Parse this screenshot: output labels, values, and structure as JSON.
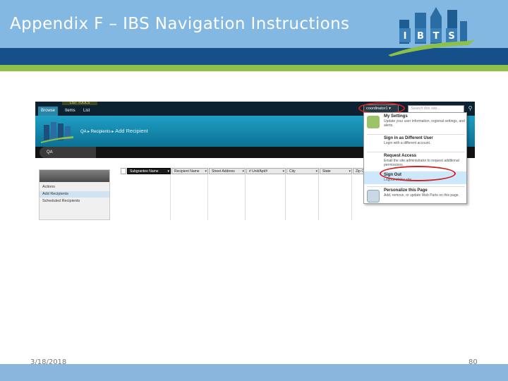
{
  "slide": {
    "title": "Appendix F – IBS Navigation Instructions",
    "date": "3/18/2018",
    "page_number": "80",
    "logo_letters": [
      "I",
      "B",
      "T",
      "S"
    ]
  },
  "screenshot": {
    "ribbon_label": "LIST TOOLS",
    "tabs": [
      "Browse",
      "Items",
      "List"
    ],
    "selected_tab": "Browse",
    "breadcrumb": {
      "site": "QA",
      "list": "Recipients",
      "page": "Add Recipient"
    },
    "user_button": "coordinator1 ▾",
    "search_placeholder": "Search this site...",
    "qa_label": "QA",
    "left_nav": [
      "Actions",
      "Add Recipients",
      "Scheduled Recipients"
    ],
    "left_nav_selected": "Add Recipients",
    "grid_columns": [
      "Subgrantee Name",
      "Recipient Name",
      "Street Address",
      "# Unit/Apt/#",
      "City",
      "State",
      "Zip Co"
    ],
    "user_menu": [
      {
        "title": "My Settings",
        "desc": "Update your user information, regional settings, and alerts."
      },
      {
        "title": "Sign in as Different User",
        "desc": "Login with a different account."
      },
      {
        "title": "Request Access",
        "desc": "Email the site administrator to request additional permissions."
      },
      {
        "title": "Sign Out",
        "desc": "Logout of this site."
      },
      {
        "title": "Personalize this Page",
        "desc": "Add, remove, or update Web Parts on this page."
      }
    ],
    "highlighted_menu_item": "Sign Out"
  },
  "colors": {
    "header": "#82b8e2",
    "navy_band": "#16508a",
    "green_band": "#8dc047",
    "highlight_circle": "#d21f1f"
  }
}
